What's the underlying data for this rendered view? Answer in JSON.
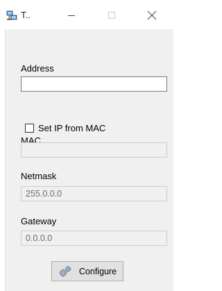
{
  "window": {
    "title": "T..",
    "icon": "network-app-icon",
    "controls": [
      "minimize",
      "maximize",
      "close"
    ]
  },
  "form": {
    "address": {
      "label": "Address",
      "value": ""
    },
    "set_ip_from_mac": {
      "label": "Set IP from MAC",
      "checked": false
    },
    "mac": {
      "label": "MAC",
      "value": ""
    },
    "netmask": {
      "label": "Netmask",
      "value": "255.0.0.0"
    },
    "gateway": {
      "label": "Gateway",
      "value": "0.0.0.0"
    }
  },
  "configure_button": {
    "label": "Configure",
    "icon": "gears-icon"
  }
}
